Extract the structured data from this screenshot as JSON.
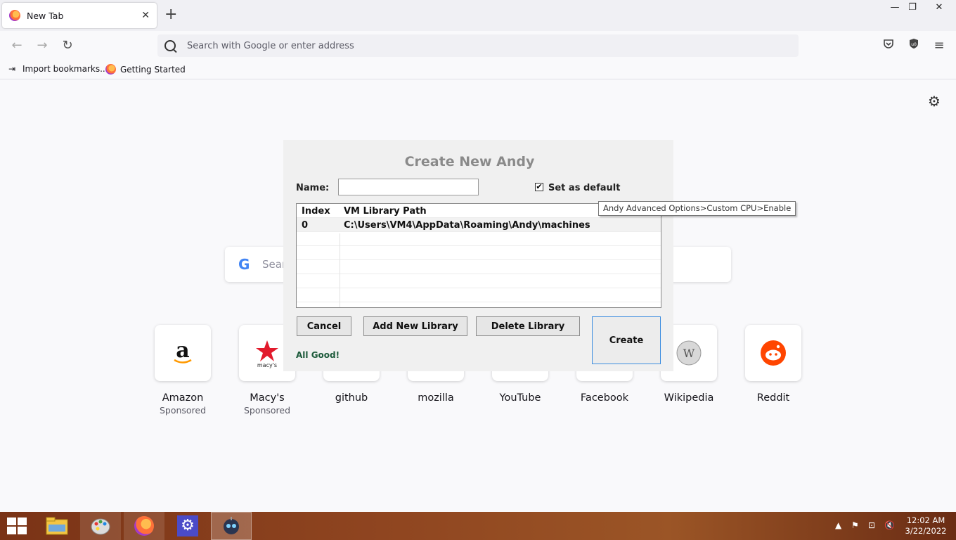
{
  "browser": {
    "tab_title": "New Tab",
    "tab_close": "✕",
    "new_tab": "+",
    "url_placeholder": "Search with Google or enter address",
    "bookmarks": [
      {
        "label": "Import bookmarks..."
      },
      {
        "label": "Getting Started"
      }
    ],
    "window_controls": {
      "minimize": "—",
      "restore": "❐",
      "close": "✕"
    }
  },
  "newtab": {
    "search_placeholder": "Sear",
    "tiles": [
      {
        "label": "Amazon",
        "sub": "Sponsored",
        "icon": "amazon-logo"
      },
      {
        "label": "Macy's",
        "sub": "Sponsored",
        "icon": "macys-logo"
      },
      {
        "label": "github",
        "sub": "",
        "icon": "github-logo"
      },
      {
        "label": "mozilla",
        "sub": "",
        "icon": "mozilla-logo"
      },
      {
        "label": "YouTube",
        "sub": "",
        "icon": "youtube-logo"
      },
      {
        "label": "Facebook",
        "sub": "",
        "icon": "facebook-logo"
      },
      {
        "label": "Wikipedia",
        "sub": "",
        "icon": "wikipedia-logo"
      },
      {
        "label": "Reddit",
        "sub": "",
        "icon": "reddit-logo"
      }
    ]
  },
  "dialog": {
    "title": "Create New Andy",
    "name_label": "Name:",
    "name_value": "",
    "set_default_label": "Set as default",
    "set_default_checked": true,
    "table": {
      "headers": [
        "Index",
        "VM Library Path"
      ],
      "rows": [
        [
          "0",
          "C:\\Users\\VM4\\AppData\\Roaming\\Andy\\machines"
        ]
      ]
    },
    "buttons": {
      "cancel": "Cancel",
      "add_library": "Add New Library",
      "delete_library": "Delete Library",
      "create": "Create"
    },
    "status": "All Good!"
  },
  "tooltip": "Andy Advanced Options>Custom CPU>Enable",
  "taskbar": {
    "time": "12:02 AM",
    "date": "3/22/2022"
  }
}
